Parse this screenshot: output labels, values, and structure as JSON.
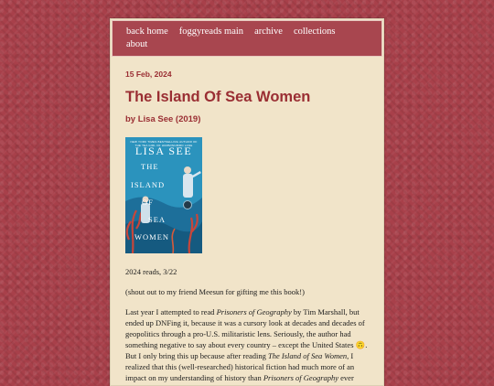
{
  "nav": {
    "items": [
      "back home",
      "foggyreads main",
      "archive",
      "collections",
      "about"
    ]
  },
  "post": {
    "date": "15 Feb, 2024",
    "title": "The Island Of Sea Women",
    "byline": "by Lisa See (2019)",
    "cover": {
      "tagline": "NEW YORK TIMES BESTSELLING AUTHOR OF THE TEA GIRL OF HUMMINGBIRD LANE",
      "author": "LISA SEE",
      "title_words": [
        "THE",
        "ISLAND",
        "OF",
        "SEA",
        "WOMEN"
      ],
      "colors": {
        "background": "#2b93bd",
        "coral": "#c8463a",
        "text": "#ffffff"
      }
    },
    "reads_line": "2024 reads, 3/22",
    "shoutout": "(shout out to my friend Meesun for gifting me this book!)",
    "body_parts": {
      "a": "Last year I attempted to read ",
      "a_em": "Prisoners of Geography",
      "b": " by Tim Marshall, but ended up DNFing it, because it was a cursory look at decades and decades of geopolitics through a pro-U.S. militaristic lens. Seriously, the author had something negative to say about every country – except the United States ",
      "emoji": "🙃",
      "c": ". But I only bring this up because after reading ",
      "c_em": "The Island of Sea Women",
      "d": ", I realized that this (well-researched) historical fiction had much more of an impact on my understanding of history than ",
      "d_em": "Prisoners of Geography",
      "e": " ever"
    }
  }
}
